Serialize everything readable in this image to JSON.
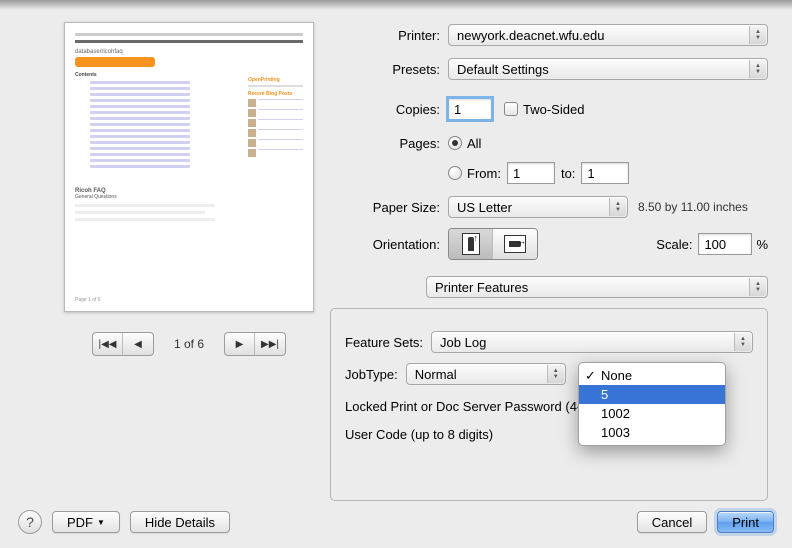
{
  "labels": {
    "printer": "Printer:",
    "presets": "Presets:",
    "copies": "Copies:",
    "two_sided": "Two-Sided",
    "pages": "Pages:",
    "all": "All",
    "from": "From:",
    "to": "to:",
    "paper_size": "Paper Size:",
    "orientation": "Orientation:",
    "scale": "Scale:",
    "percent": "%",
    "feature_sets": "Feature Sets:",
    "job_type": "JobType:",
    "locked_print": "Locked Print or Doc Server Password (4-8 digits):",
    "user_code": "User Code (up to 8 digits)"
  },
  "values": {
    "printer": "newyork.deacnet.wfu.edu",
    "presets": "Default Settings",
    "copies": "1",
    "pages_from": "1",
    "pages_to": "1",
    "paper_size": "US Letter",
    "paper_dims": "8.50 by 11.00 inches",
    "scale": "100",
    "section": "Printer Features",
    "feature_set": "Job Log",
    "job_type": "Normal"
  },
  "pager": {
    "label": "1 of 6"
  },
  "dropdown": {
    "options": [
      "None",
      "5",
      "1002",
      "1003"
    ],
    "highlighted_index": 1,
    "checked_index": 0
  },
  "bottom": {
    "pdf": "PDF",
    "hide_details": "Hide Details",
    "cancel": "Cancel",
    "print": "Print"
  }
}
